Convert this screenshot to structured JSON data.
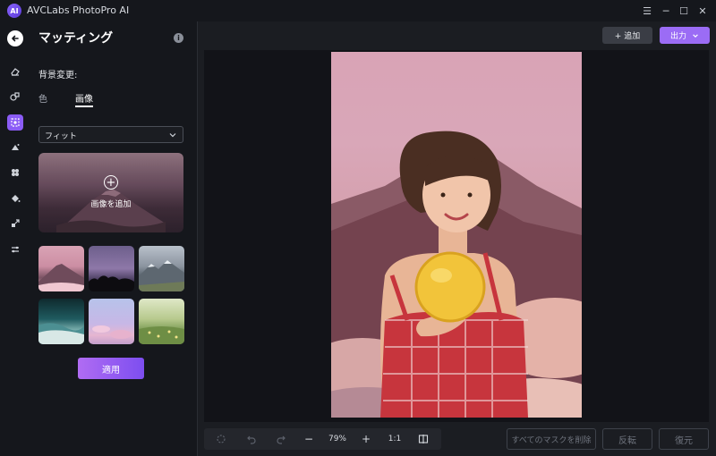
{
  "app": {
    "title": "AVCLabs PhotoPro AI",
    "logo_text": "AI"
  },
  "window_controls": {
    "menu": "☰",
    "minimize": "─",
    "maximize": "☐",
    "close": "✕"
  },
  "panel": {
    "title": "マッティング",
    "info": "i",
    "section_label": "背景変更:",
    "tabs": [
      {
        "label": "色"
      },
      {
        "label": "画像"
      }
    ],
    "active_tab": "画像",
    "fit_select": {
      "value": "フィット"
    },
    "add_image": {
      "icon": "plus-circle-icon",
      "label": "画像を追加"
    },
    "thumbnails": [
      {
        "name": "pink-mountain-sunset"
      },
      {
        "name": "purple-dusk-trees"
      },
      {
        "name": "snowy-mountains"
      },
      {
        "name": "teal-ocean-waves"
      },
      {
        "name": "pastel-pink-clouds"
      },
      {
        "name": "green-meadow"
      }
    ],
    "apply_label": "適用"
  },
  "rail_icons": [
    "eraser-icon",
    "enhance-icon",
    "matting-icon",
    "colorize-icon",
    "face-icon",
    "paint-bucket-icon",
    "upscale-icon",
    "adjust-sliders-icon"
  ],
  "header": {
    "add_label": "+ 追加",
    "export_label": "出力"
  },
  "toolbar": {
    "zoom": "79%",
    "ratio": "1:1",
    "minus": "−",
    "plus": "+"
  },
  "actions": {
    "clear_masks": "すべてのマスクを削除",
    "invert": "反転",
    "restore": "復元"
  },
  "colors": {
    "accent": "#8b5cf6",
    "accent_gradient_start": "#b06cf3",
    "background": "#15171c",
    "canvas": "#121318"
  }
}
